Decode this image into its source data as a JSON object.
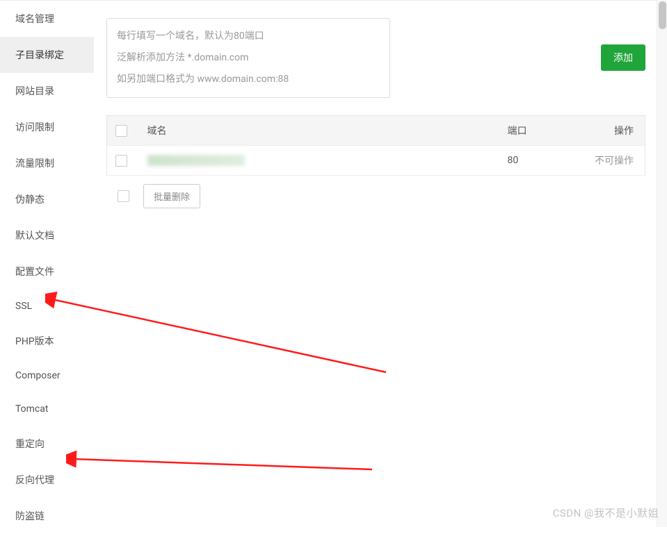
{
  "sidebar": {
    "items": [
      {
        "label": "域名管理"
      },
      {
        "label": "子目录绑定"
      },
      {
        "label": "网站目录"
      },
      {
        "label": "访问限制"
      },
      {
        "label": "流量限制"
      },
      {
        "label": "伪静态"
      },
      {
        "label": "默认文档"
      },
      {
        "label": "配置文件"
      },
      {
        "label": "SSL"
      },
      {
        "label": "PHP版本"
      },
      {
        "label": "Composer"
      },
      {
        "label": "Tomcat"
      },
      {
        "label": "重定向"
      },
      {
        "label": "反向代理"
      },
      {
        "label": "防盗链"
      }
    ],
    "active_index": 1
  },
  "form": {
    "textarea_placeholder": "每行填写一个域名，默认为80端口\n泛解析添加方法 *.domain.com\n如另加端口格式为 www.domain.com:88",
    "add_button": "添加"
  },
  "table": {
    "headers": {
      "domain": "域名",
      "port": "端口",
      "action": "操作"
    },
    "rows": [
      {
        "domain": "",
        "port": "80",
        "action": "不可操作"
      }
    ]
  },
  "batch": {
    "delete_label": "批量删除"
  },
  "watermark": "CSDN @我不是小默姐"
}
